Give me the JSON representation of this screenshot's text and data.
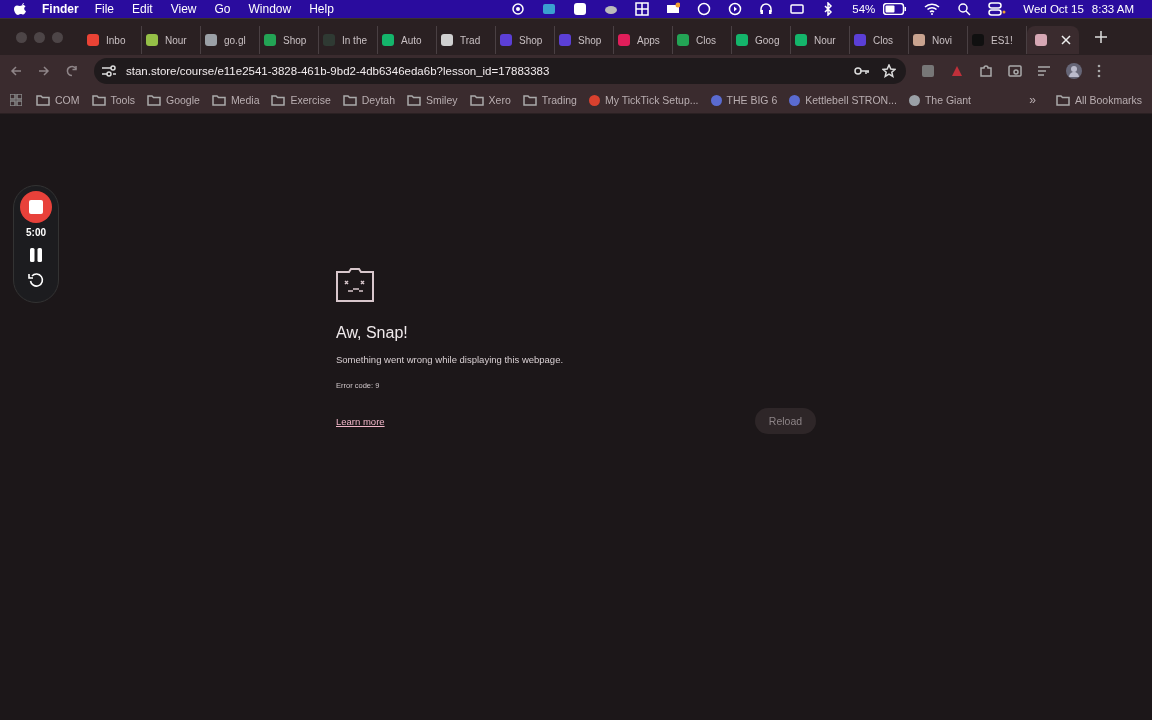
{
  "menu_bar": {
    "app": "Finder",
    "items": [
      "File",
      "Edit",
      "View",
      "Go",
      "Window",
      "Help"
    ],
    "battery": "54%",
    "date": "Wed Oct 15",
    "time": "8:33 AM"
  },
  "tabs": [
    {
      "label": "Inbo",
      "color": "#ea4335",
      "selected": false
    },
    {
      "label": "Nour",
      "color": "#95bf47",
      "selected": false
    },
    {
      "label": "go.gl",
      "color": "#9aa0a6",
      "selected": false
    },
    {
      "label": "Shop",
      "color": "#23a455",
      "selected": false
    },
    {
      "label": "In the",
      "color": "#2f3a33",
      "selected": false
    },
    {
      "label": "Auto",
      "color": "#14b56b",
      "selected": false
    },
    {
      "label": "Trad",
      "color": "#d0d0d0",
      "selected": false
    },
    {
      "label": "Shop",
      "color": "#5b3fd6",
      "selected": false
    },
    {
      "label": "Shop",
      "color": "#5b3fd6",
      "selected": false
    },
    {
      "label": "Apps",
      "color": "#e01e5a",
      "selected": false
    },
    {
      "label": "Clos",
      "color": "#23a455",
      "selected": false
    },
    {
      "label": "Goog",
      "color": "#14b56b",
      "selected": false
    },
    {
      "label": "Nour",
      "color": "#14b56b",
      "selected": false
    },
    {
      "label": "Clos",
      "color": "#5b3fd6",
      "selected": false
    },
    {
      "label": "Novi",
      "color": "#c9a38f",
      "selected": false
    },
    {
      "label": "ES1!",
      "color": "#101010",
      "selected": false
    },
    {
      "color": "#d6a7b4",
      "selected": true
    }
  ],
  "address": "stan.store/course/e11e2541-3828-461b-9bd2-4db6346eda6b?lesson_id=17883383",
  "bookmarks": [
    {
      "label": "COM",
      "kind": "folder"
    },
    {
      "label": "Tools",
      "kind": "folder"
    },
    {
      "label": "Google",
      "kind": "folder"
    },
    {
      "label": "Media",
      "kind": "folder"
    },
    {
      "label": "Exercise",
      "kind": "folder"
    },
    {
      "label": "Deytah",
      "kind": "folder"
    },
    {
      "label": "Smiley",
      "kind": "folder"
    },
    {
      "label": "Xero",
      "kind": "folder"
    },
    {
      "label": "Trading",
      "kind": "folder"
    },
    {
      "label": "My TickTick Setup...",
      "kind": "site",
      "color": "#d9412e"
    },
    {
      "label": "THE BIG 6",
      "kind": "site",
      "color": "#5a6bd0"
    },
    {
      "label": "Kettlebell STRON...",
      "kind": "site",
      "color": "#5a6bd0"
    },
    {
      "label": "The Giant",
      "kind": "site",
      "color": "#9aa0a6"
    }
  ],
  "bookmarks_overflow": "»",
  "all_bookmarks": "All Bookmarks",
  "recorder": {
    "time": "5:00"
  },
  "error": {
    "title": "Aw, Snap!",
    "message": "Something went wrong while displaying this webpage.",
    "code": "Error code: 9",
    "link": "Learn more",
    "button": "Reload"
  }
}
